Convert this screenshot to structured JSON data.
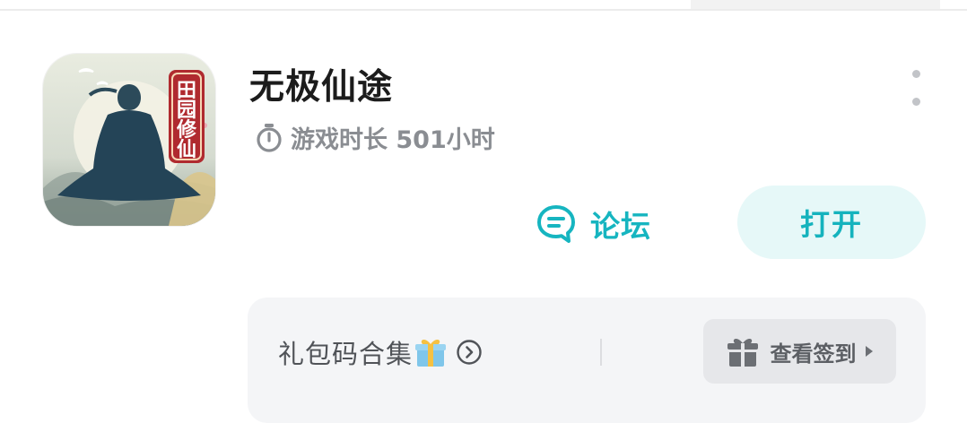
{
  "app": {
    "title": "无极仙途",
    "icon_badge": "田园修仙",
    "icon": "game-app-icon"
  },
  "playtime": {
    "icon": "timer-icon",
    "text": "游戏时长 501小时"
  },
  "actions": {
    "more_icon": "more-vertical-icon",
    "forum_icon": "chat-bubble-icon",
    "forum_label": "论坛",
    "open_label": "打开"
  },
  "gift_panel": {
    "label": "礼包码合集",
    "emoji_icon": "gift-emoji-icon",
    "arrow_icon": "circle-chevron-right-icon",
    "checkin_icon": "gift-box-icon",
    "checkin_label": "查看签到",
    "caret_icon": "caret-right-icon"
  },
  "colors": {
    "accent": "#16b5c0",
    "accent_bg": "#e6f8f8",
    "panel_bg": "#f4f5f7",
    "text_primary": "#1c1c1c",
    "text_secondary": "#8a8d92"
  }
}
